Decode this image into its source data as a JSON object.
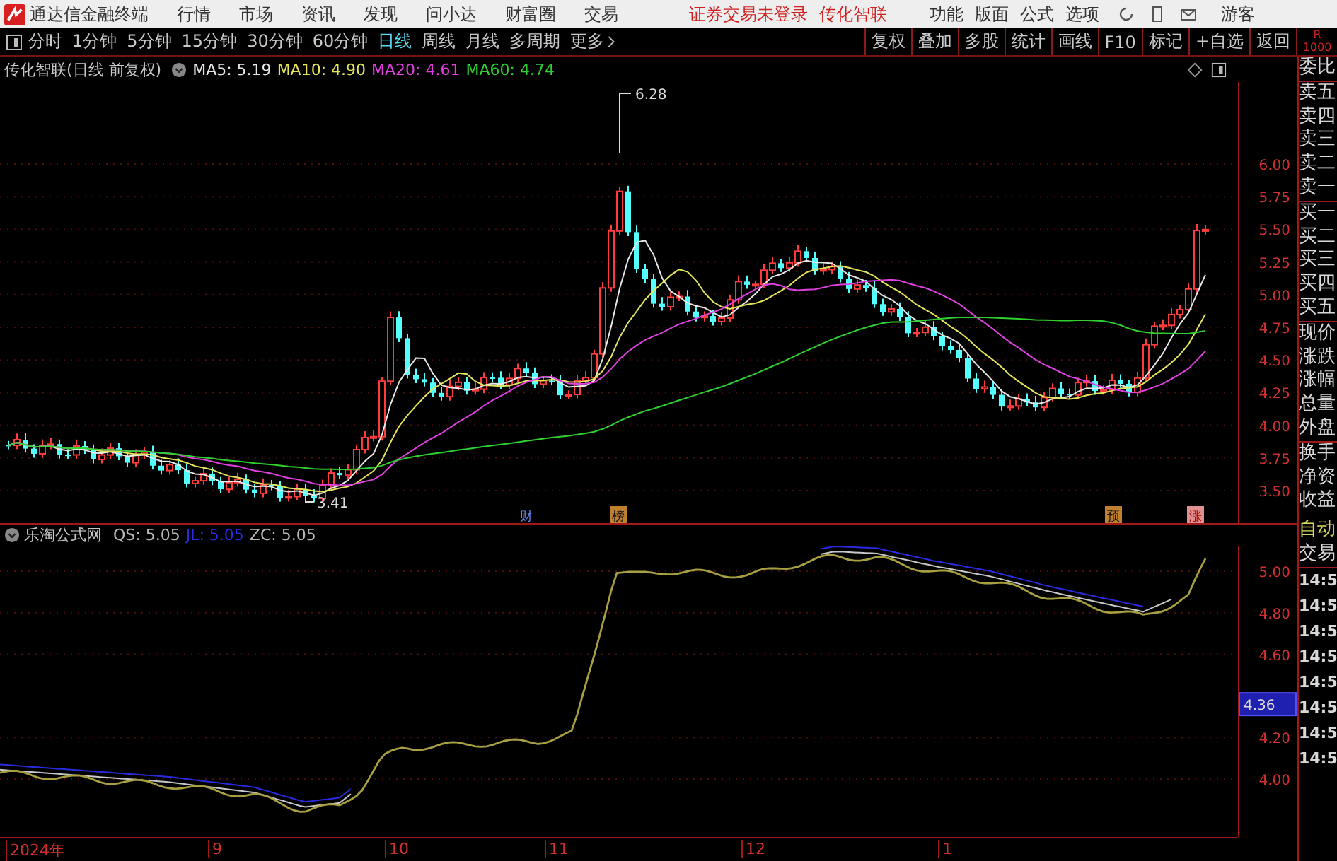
{
  "top_bar": {
    "app_name": "通达信金融终端",
    "menu": [
      "行情",
      "市场",
      "资讯",
      "发现",
      "问小达",
      "财富圈",
      "交易"
    ],
    "notice": "证券交易未登录",
    "stock_link": "传化智联",
    "tools": [
      "功能",
      "版面",
      "公式",
      "选项"
    ],
    "user": "游客"
  },
  "toolbar": {
    "periods": [
      {
        "label": "分时",
        "selected": false
      },
      {
        "label": "1分钟",
        "selected": false
      },
      {
        "label": "5分钟",
        "selected": false
      },
      {
        "label": "15分钟",
        "selected": false
      },
      {
        "label": "30分钟",
        "selected": false
      },
      {
        "label": "60分钟",
        "selected": false
      },
      {
        "label": "日线",
        "selected": true
      },
      {
        "label": "周线",
        "selected": false
      },
      {
        "label": "月线",
        "selected": false
      },
      {
        "label": "多周期",
        "selected": false
      }
    ],
    "more": "更多",
    "actions": [
      "复权",
      "叠加",
      "多股",
      "统计",
      "画线",
      "F10",
      "标记",
      "+自选",
      "返回"
    ],
    "corner": [
      "R",
      "1000"
    ]
  },
  "price_chart": {
    "title": "传化智联(日线 前复权)",
    "ma": [
      {
        "label": "MA5: 5.19",
        "color": "#e8e8e8"
      },
      {
        "label": "MA10: 4.90",
        "color": "#e6e65a"
      },
      {
        "label": "MA20: 4.61",
        "color": "#e040e0"
      },
      {
        "label": "MA60: 4.74",
        "color": "#30d030"
      }
    ],
    "y_ticks": [
      "6.00",
      "5.75",
      "5.50",
      "5.25",
      "5.00",
      "4.75",
      "4.50",
      "4.25",
      "4.00",
      "3.75",
      "3.50"
    ],
    "high_label": "6.28",
    "low_label": "3.41",
    "markers": [
      "财",
      "榜",
      "预",
      "涨"
    ]
  },
  "indicator": {
    "title": "乐淘公式网",
    "values": [
      {
        "label": "QS: 5.05",
        "color": "#b8b8b8"
      },
      {
        "label": "JL: 5.05",
        "color": "#2a2ae0"
      },
      {
        "label": "ZC: 5.05",
        "color": "#b8b8b8"
      }
    ],
    "y_ticks": [
      "5.00",
      "4.80",
      "4.60",
      "4.20",
      "4.00"
    ],
    "current": "4.36"
  },
  "x_axis": [
    "2024年",
    "9",
    "10",
    "11",
    "12",
    "1"
  ],
  "side_panel": {
    "labels": [
      "委比",
      "卖五",
      "卖四",
      "卖三",
      "卖二",
      "卖一",
      "买一",
      "买二",
      "买三",
      "买四",
      "买五",
      "现价",
      "涨跌",
      "涨幅",
      "总量",
      "外盘",
      "换手",
      "净资",
      "收益"
    ],
    "mode": "自动",
    "trade_label": "交易",
    "times": [
      "14:5",
      "14:5",
      "14:5",
      "14:5",
      "14:5",
      "14:5",
      "14:5",
      "14:5"
    ]
  }
}
